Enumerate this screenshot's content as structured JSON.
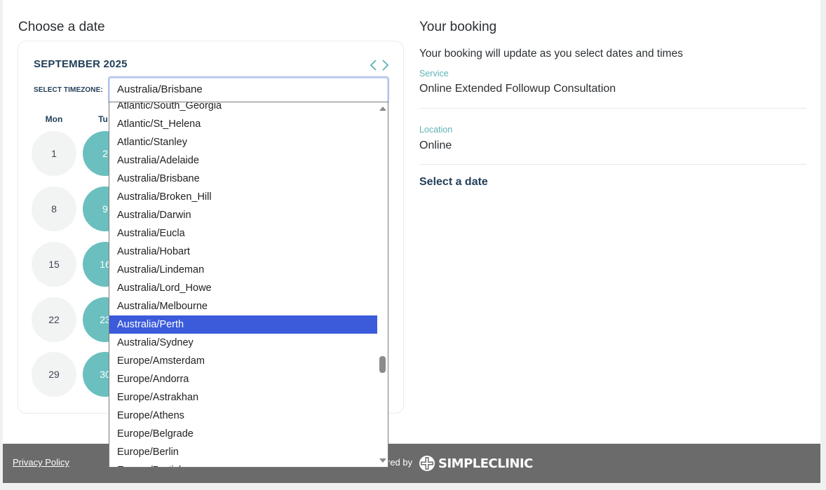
{
  "left": {
    "title": "Choose a date"
  },
  "calendar": {
    "month": "SEPTEMBER 2025",
    "timezone_label": "SELECT TIMEZONE:",
    "timezone_value": "Australia/Brisbane",
    "day_headers": [
      "Mon",
      "Tu"
    ],
    "rows": [
      {
        "mon": "1",
        "tue": "2"
      },
      {
        "mon": "8",
        "tue": "9"
      },
      {
        "mon": "15",
        "tue": "16"
      },
      {
        "mon": "22",
        "tue": "23"
      },
      {
        "mon": "29",
        "tue": "30"
      }
    ]
  },
  "dropdown": {
    "options": [
      "Atlantic/South_Georgia",
      "Atlantic/St_Helena",
      "Atlantic/Stanley",
      "Australia/Adelaide",
      "Australia/Brisbane",
      "Australia/Broken_Hill",
      "Australia/Darwin",
      "Australia/Eucla",
      "Australia/Hobart",
      "Australia/Lindeman",
      "Australia/Lord_Howe",
      "Australia/Melbourne",
      "Australia/Perth",
      "Australia/Sydney",
      "Europe/Amsterdam",
      "Europe/Andorra",
      "Europe/Astrakhan",
      "Europe/Athens",
      "Europe/Belgrade",
      "Europe/Berlin",
      "Europe/Bratislava"
    ],
    "highlighted": "Australia/Perth"
  },
  "booking": {
    "title": "Your booking",
    "subtitle": "Your booking will update as you select dates and times",
    "service_label": "Service",
    "service_value": "Online Extended Followup Consultation",
    "location_label": "Location",
    "location_value": "Online",
    "select_date": "Select a date"
  },
  "footer": {
    "privacy": "Privacy Policy",
    "powered_by": "red by",
    "logo_text": "SIMPLECLINIC"
  },
  "colors": {
    "accent_teal": "#6bbfbf",
    "heading_navy": "#22405a",
    "highlight_blue": "#3b5bdb",
    "footer_gray": "#6b6b6b"
  }
}
